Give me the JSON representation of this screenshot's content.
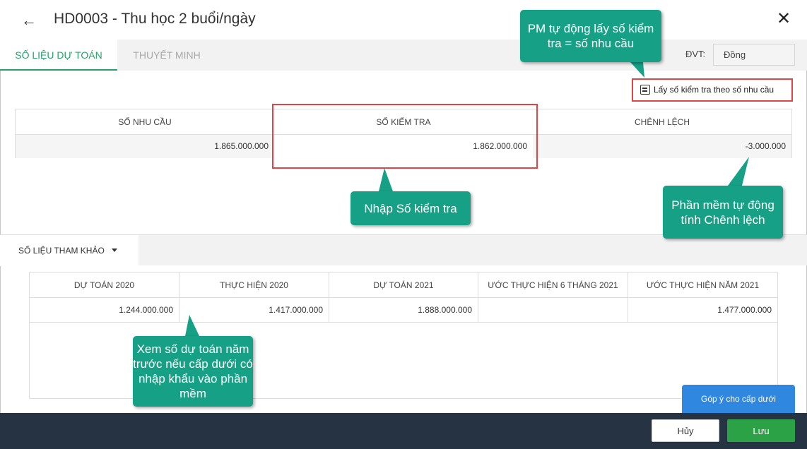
{
  "header": {
    "title": "HD0003 - Thu học 2 buổi/ngày",
    "back_icon": "←",
    "close_icon": "✕"
  },
  "tabs": [
    {
      "label": "SỐ LIỆU DỰ TOÁN",
      "active": true
    },
    {
      "label": "THUYẾT MINH",
      "active": false
    }
  ],
  "unit": {
    "label": "ĐVT:",
    "value": "Đồng"
  },
  "action_link": {
    "label": "Lấy số kiểm tra theo số nhu cầu"
  },
  "main_table": {
    "headers": [
      "SỐ NHU CẦU",
      "SỐ KIỂM TRA",
      "CHÊNH LỆCH"
    ],
    "row": [
      "1.865.000.000",
      "1.862.000.000",
      "-3.000.000"
    ]
  },
  "reference": {
    "tab_label": "SỐ LIỆU THAM KHẢO",
    "headers": [
      "DỰ TOÁN 2020",
      "THỰC HIỆN 2020",
      "DỰ TOÁN 2021",
      "ƯỚC THỰC HIỆN 6 THÁNG 2021",
      "ƯỚC THỰC HIỆN NĂM 2021"
    ],
    "row": [
      "1.244.000.000",
      "1.417.000.000",
      "1.888.000.000",
      "",
      "1.477.000.000"
    ]
  },
  "callouts": {
    "auto_fetch": "PM tự động lấy số kiểm tra = số nhu cầu",
    "enter_check": "Nhập Số kiểm tra",
    "auto_diff": "Phần mềm tự động tính Chênh lệch",
    "view_prev": "Xem số dự toán năm trước nếu cấp dưới có nhập khẩu vào phần mềm"
  },
  "feedback_button": "Góp ý cho cấp dưới",
  "footer": {
    "cancel": "Hủy",
    "save": "Lưu"
  },
  "colors": {
    "accent_green": "#26a269",
    "callout_teal": "#16a085",
    "highlight_red": "#e04444",
    "footer_dark": "#253342",
    "save_green": "#2aa245",
    "feedback_blue": "#2f87e0"
  }
}
